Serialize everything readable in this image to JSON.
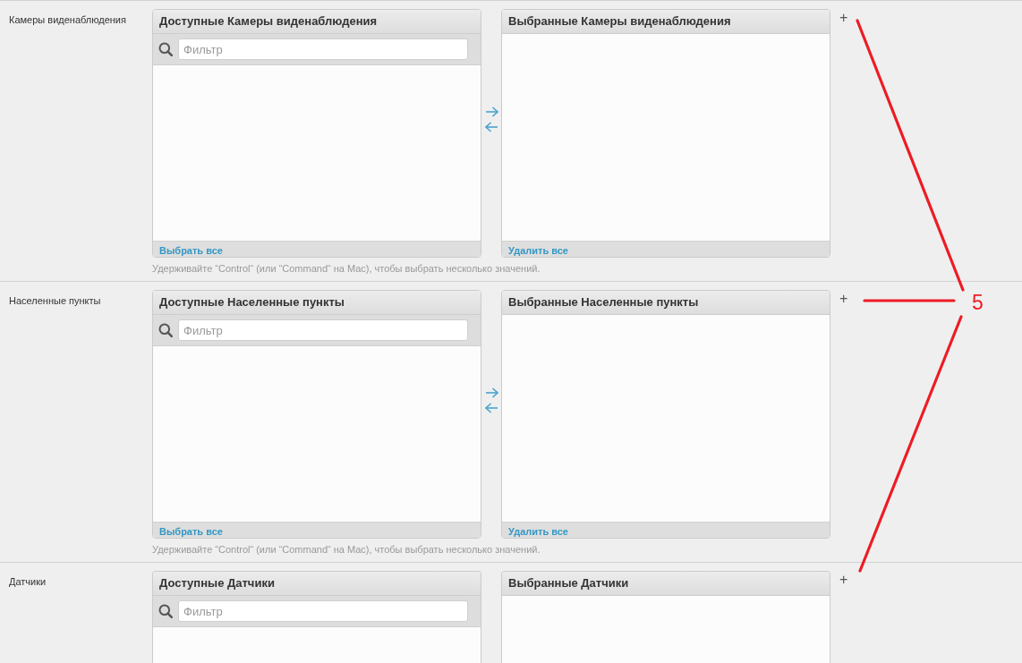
{
  "fields": [
    {
      "label": "Камеры виденаблюдения",
      "available": {
        "title": "Доступные Камеры виденаблюдения",
        "filter_placeholder": "Фильтр",
        "footer_link": "Выбрать все"
      },
      "chosen": {
        "title": "Выбранные Камеры виденаблюдения",
        "footer_link": "Удалить все"
      },
      "add_link": "+",
      "help_text": "Удерживайте “Control“ (или “Command“ на Mac), чтобы выбрать несколько значений."
    },
    {
      "label": "Населенные пункты",
      "available": {
        "title": "Доступные Населенные пункты",
        "filter_placeholder": "Фильтр",
        "footer_link": "Выбрать все"
      },
      "chosen": {
        "title": "Выбранные Населенные пункты",
        "footer_link": "Удалить все"
      },
      "add_link": "+",
      "help_text": "Удерживайте “Control“ (или “Command“ на Mac), чтобы выбрать несколько значений."
    },
    {
      "label": "Датчики",
      "available": {
        "title": "Доступные Датчики",
        "filter_placeholder": "Фильтр"
      },
      "chosen": {
        "title": "Выбранные Датчики"
      },
      "add_link": "+"
    }
  ],
  "annotation": {
    "label": "5"
  }
}
